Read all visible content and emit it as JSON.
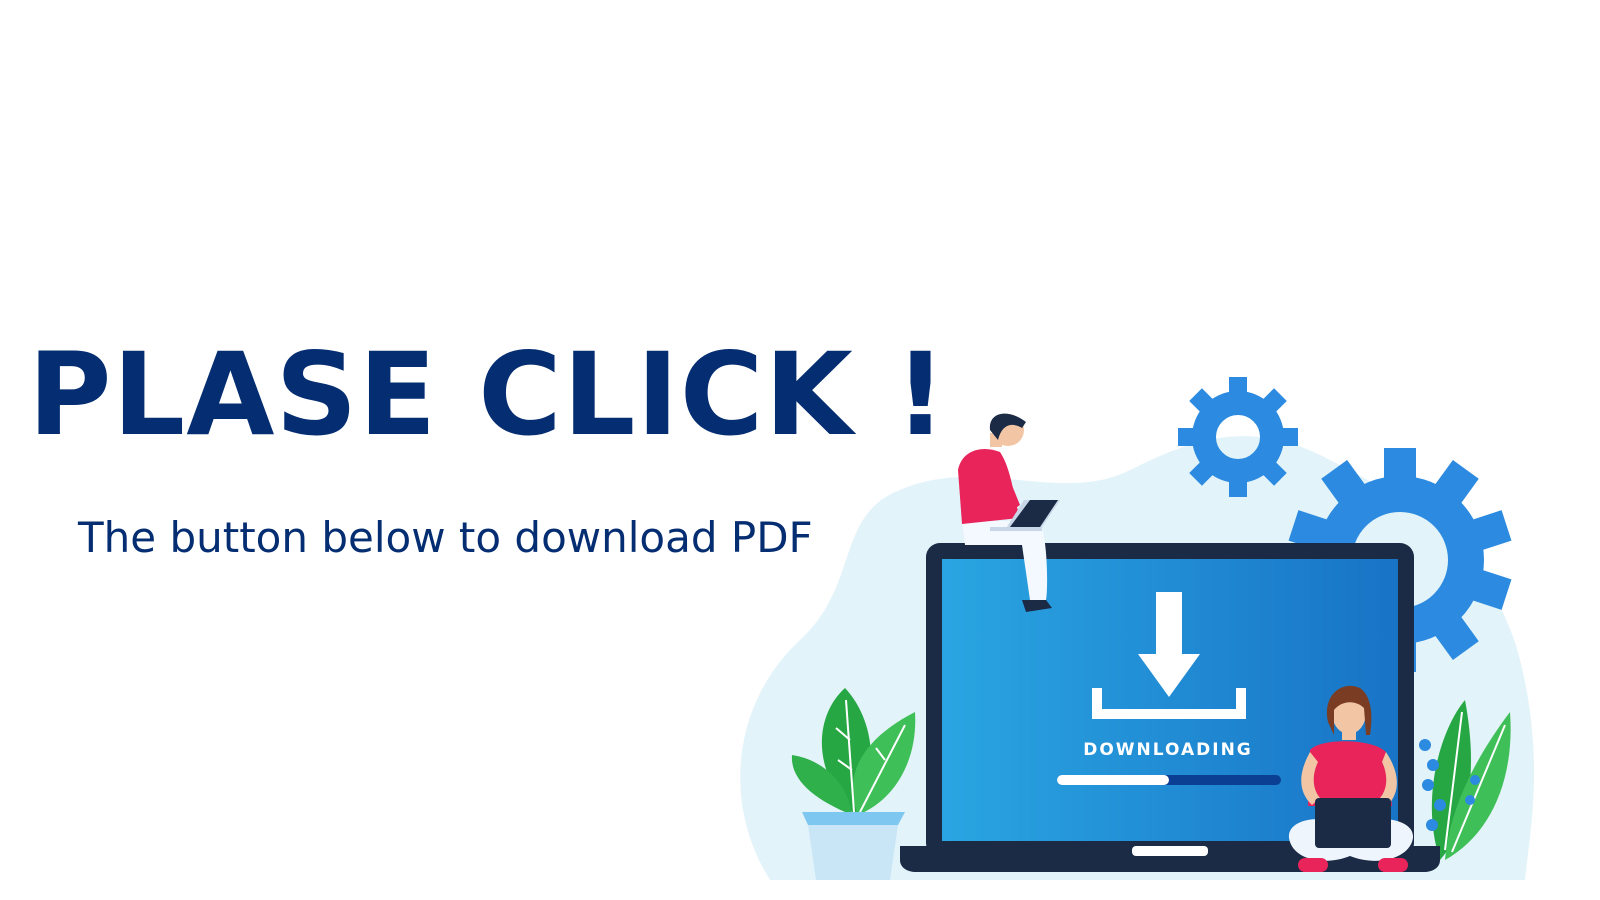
{
  "headline": "PLASE CLICK !",
  "subline": "The button below to download PDF",
  "illustration": {
    "status_label": "DOWNLOADING",
    "progress_fraction": 0.5
  },
  "colors": {
    "headline_text": "#052d72",
    "screen_blue": "#1f8fd8",
    "laptop_frame": "#1b2a45",
    "gear_blue": "#2c8be0",
    "blob": "#e3f3fa",
    "leaf_green": "#27a743",
    "shirt_red": "#e8245a"
  }
}
